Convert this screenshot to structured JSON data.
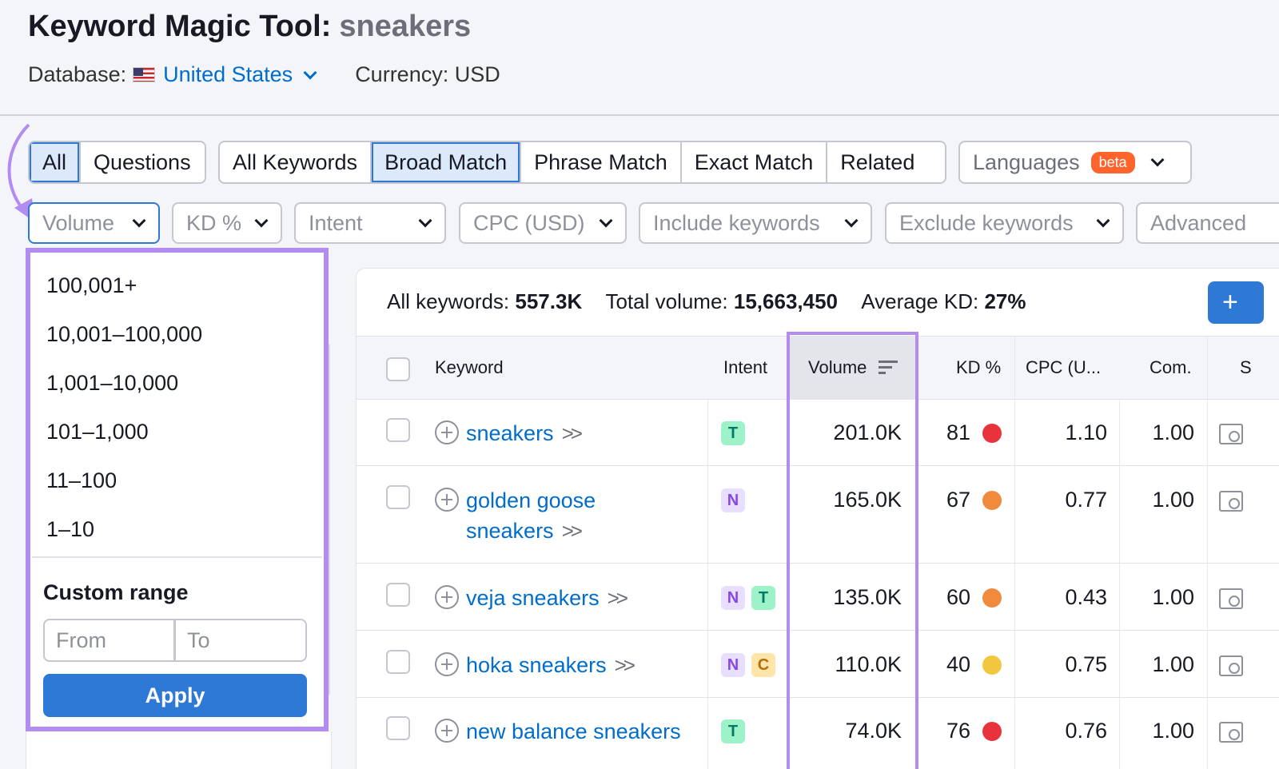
{
  "header": {
    "title": "Keyword Magic Tool:",
    "query": "sneakers",
    "database_label": "Database:",
    "country": "United States",
    "currency": "Currency: USD"
  },
  "match_tabs": {
    "group1": [
      "All",
      "Questions"
    ],
    "group2": [
      "All Keywords",
      "Broad Match",
      "Phrase Match",
      "Exact Match",
      "Related"
    ],
    "active1": "All",
    "active2": "Broad Match"
  },
  "languages": {
    "label": "Languages",
    "badge": "beta"
  },
  "filters": [
    "Volume",
    "KD %",
    "Intent",
    "CPC (USD)",
    "Include keywords",
    "Exclude keywords",
    "Advanced"
  ],
  "volume_dropdown": {
    "options": [
      "100,001+",
      "10,001–100,000",
      "1,001–10,000",
      "101–1,000",
      "11–100",
      "1–10"
    ],
    "custom_range_label": "Custom range",
    "from_placeholder": "From",
    "to_placeholder": "To",
    "apply_label": "Apply"
  },
  "summary": {
    "all_keywords_label": "All keywords:",
    "all_keywords_value": "557.3K",
    "total_volume_label": "Total volume:",
    "total_volume_value": "15,663,450",
    "avg_kd_label": "Average KD:",
    "avg_kd_value": "27%",
    "add_button": "+"
  },
  "table": {
    "columns": [
      "Keyword",
      "Intent",
      "Volume",
      "KD %",
      "CPC (U...",
      "Com.",
      "S"
    ],
    "rows": [
      {
        "keyword": "sneakers",
        "keyword_line2": "",
        "intents": [
          "T"
        ],
        "volume": "201.0K",
        "kd": "81",
        "kd_color": "#e8333c",
        "cpc": "1.10",
        "com": "1.00"
      },
      {
        "keyword": "golden goose",
        "keyword_line2": "sneakers",
        "intents": [
          "N"
        ],
        "volume": "165.0K",
        "kd": "67",
        "kd_color": "#f08a3c",
        "cpc": "0.77",
        "com": "1.00"
      },
      {
        "keyword": "veja sneakers",
        "keyword_line2": "",
        "intents": [
          "N",
          "T"
        ],
        "volume": "135.0K",
        "kd": "60",
        "kd_color": "#f08a3c",
        "cpc": "0.43",
        "com": "1.00"
      },
      {
        "keyword": "hoka sneakers",
        "keyword_line2": "",
        "intents": [
          "N",
          "C"
        ],
        "volume": "110.0K",
        "kd": "40",
        "kd_color": "#f2c740",
        "cpc": "0.75",
        "com": "1.00"
      },
      {
        "keyword": "new balance sneakers",
        "keyword_line2": "",
        "intents": [
          "T"
        ],
        "volume": "74.0K",
        "kd": "76",
        "kd_color": "#e8333c",
        "cpc": "0.76",
        "com": "1.00"
      }
    ]
  },
  "colors": {
    "accent": "#2e79d6",
    "highlight": "#b28cf0",
    "link": "#006dca"
  }
}
